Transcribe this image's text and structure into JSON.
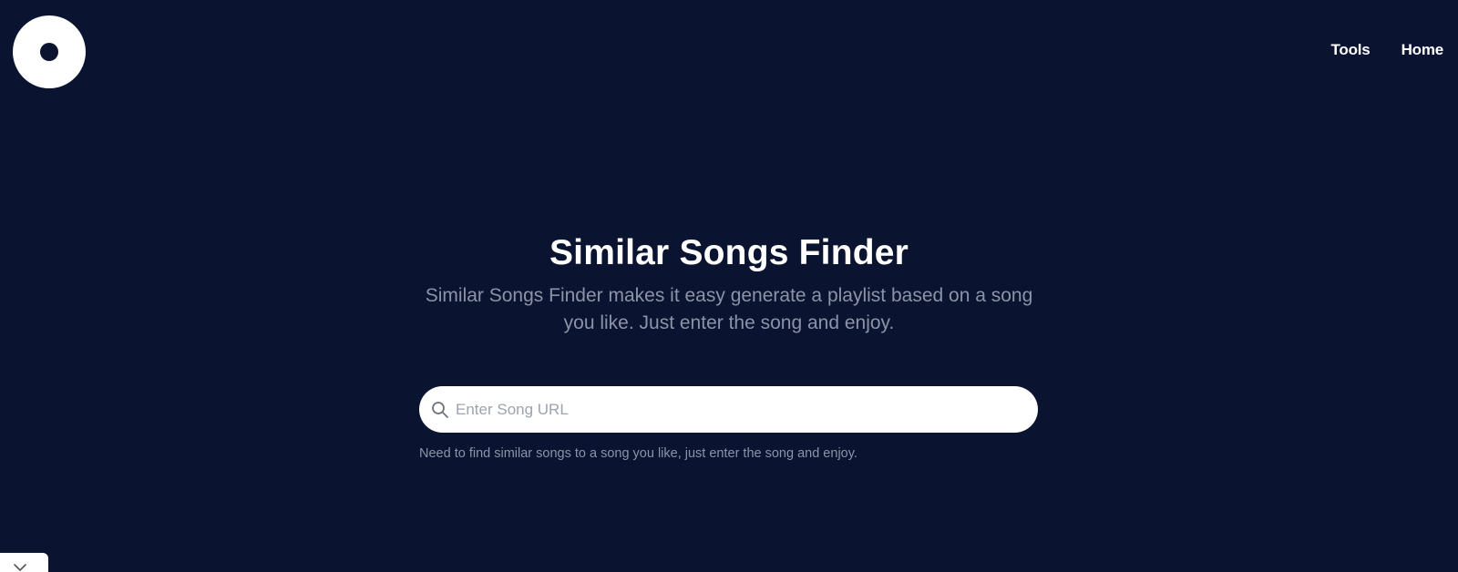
{
  "logo": {
    "icon": "vinyl-disc-icon"
  },
  "nav": {
    "items": [
      {
        "label": "Tools"
      },
      {
        "label": "Home"
      }
    ]
  },
  "hero": {
    "title": "Similar Songs Finder",
    "subtitle": "Similar Songs Finder makes it easy generate a playlist based on a song you like. Just enter the song and enjoy."
  },
  "search": {
    "placeholder": "Enter Song URL",
    "value": "",
    "icon": "search-icon",
    "helper_text": "Need to find similar songs to a song you like, just enter the song and enjoy."
  },
  "corner_toggle": {
    "icon": "chevron-down-icon"
  },
  "colors": {
    "background": "#0a1430",
    "text_primary": "#ffffff",
    "text_muted": "#8c93a8",
    "input_bg": "#ffffff"
  }
}
